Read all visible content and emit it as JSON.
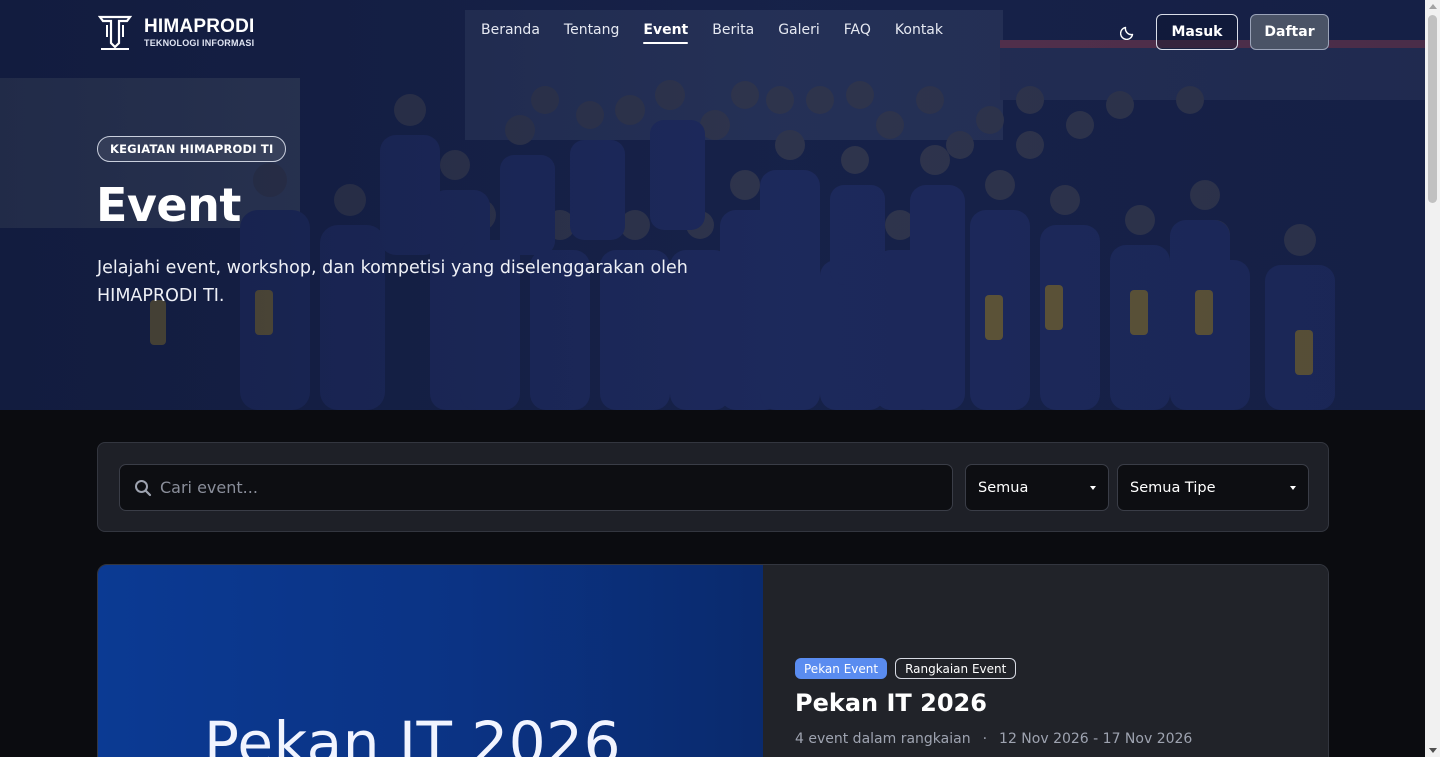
{
  "brand": {
    "title": "HIMAPRODI",
    "subtitle": "TEKNOLOGI INFORMASI",
    "logo_icon": "himaprodi-logo-icon"
  },
  "nav": {
    "items": [
      {
        "label": "Beranda",
        "active": false
      },
      {
        "label": "Tentang",
        "active": false
      },
      {
        "label": "Event",
        "active": true
      },
      {
        "label": "Berita",
        "active": false
      },
      {
        "label": "Galeri",
        "active": false
      },
      {
        "label": "FAQ",
        "active": false
      },
      {
        "label": "Kontak",
        "active": false
      }
    ],
    "theme_icon": "moon-icon",
    "login_label": "Masuk",
    "register_label": "Daftar"
  },
  "hero": {
    "badge": "KEGIATAN HIMAPRODI TI",
    "title": "Event",
    "description": "Jelajahi event, workshop, dan kompetisi yang diselenggarakan oleh HIMAPRODI TI."
  },
  "filters": {
    "search_placeholder": "Cari event...",
    "search_value": "",
    "status_selected": "Semua",
    "type_selected": "Semua Tipe"
  },
  "featured": {
    "banner_title": "Pekan IT 2026",
    "tags": [
      "Pekan Event",
      "Rangkaian Event"
    ],
    "title": "Pekan IT 2026",
    "count_text": "4 event dalam rangkaian",
    "separator": "·",
    "date_range": "12 Nov 2026 - 17 Nov 2026"
  },
  "colors": {
    "accent": "#5a8cf0",
    "background": "#0b0c10",
    "card": "#1e2027",
    "banner": "#0b3a93"
  }
}
